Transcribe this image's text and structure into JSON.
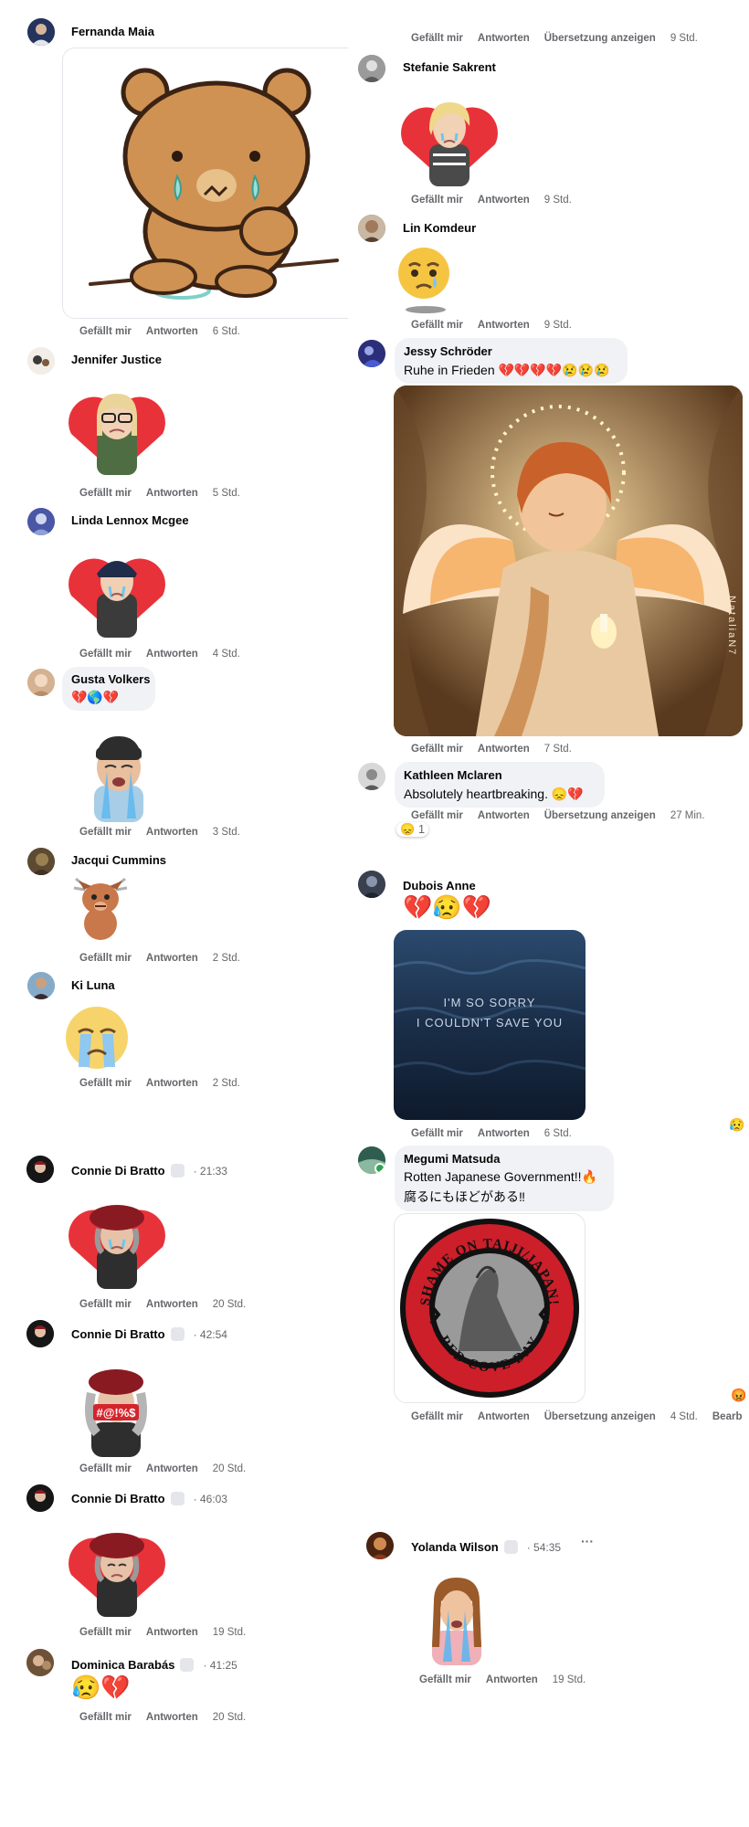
{
  "labels": {
    "like": "Gefällt mir",
    "reply": "Antworten",
    "translate": "Übersetzung anzeigen"
  },
  "left": [
    {
      "name": "Fernanda Maia",
      "time": "6 Std."
    },
    {
      "name": "Jennifer Justice",
      "time": "5 Std."
    },
    {
      "name": "Linda Lennox Mcgee",
      "time": "4 Std."
    },
    {
      "name": "Gusta Volkers",
      "text": "💔🌎💔",
      "time": "3 Std."
    },
    {
      "name": "Jacqui Cummins",
      "time": "2 Std."
    },
    {
      "name": "Ki Luna",
      "time": "2 Std."
    },
    {
      "name": "Connie Di Bratto",
      "meta": "· 21:33",
      "time": "20 Std."
    },
    {
      "name": "Connie Di Bratto",
      "meta": "· 42:54",
      "time": "20 Std.",
      "sign": "#@!%$"
    },
    {
      "name": "Connie Di Bratto",
      "meta": "· 46:03",
      "time": "19 Std."
    },
    {
      "name": "Dominica Barabás",
      "meta": "· 41:25",
      "text": "😥💔",
      "time": "20 Std."
    }
  ],
  "right": [
    {
      "time": "9 Std."
    },
    {
      "name": "Stefanie Sakrent",
      "time": "9 Std."
    },
    {
      "name": "Lin Komdeur",
      "time": "9 Std."
    },
    {
      "name": "Jessy Schröder",
      "text": "Ruhe in Frieden 💔💔💔💔😢😢😢",
      "time": "7 Std.",
      "watermark": "NataliaN7"
    },
    {
      "name": "Kathleen Mclaren",
      "text": "Absolutely heartbreaking. 😞💔",
      "time": "27 Min.",
      "reaction_count": "1"
    },
    {
      "name": "Dubois Anne",
      "text": "💔😥💔",
      "image_line1": "I'M SO SORRY",
      "image_line2": "I COULDN'T SAVE YOU",
      "time": "6 Std."
    },
    {
      "name": "Megumi Matsuda",
      "line1": "Rotten Japanese Government!!🔥",
      "line2": "腐るにもほどがある‼",
      "logo_top": "SHAME ON TAIJI/JAPAN!",
      "logo_bottom": "RED COVE DAY",
      "time": "4 Std.",
      "extra": "Bearb"
    },
    {
      "name": "Yolanda Wilson",
      "meta": "· 54:35",
      "time": "19 Std."
    }
  ],
  "colors": {
    "heart": "#e8323a",
    "action": "#65676b",
    "bubble": "#f0f2f5"
  }
}
